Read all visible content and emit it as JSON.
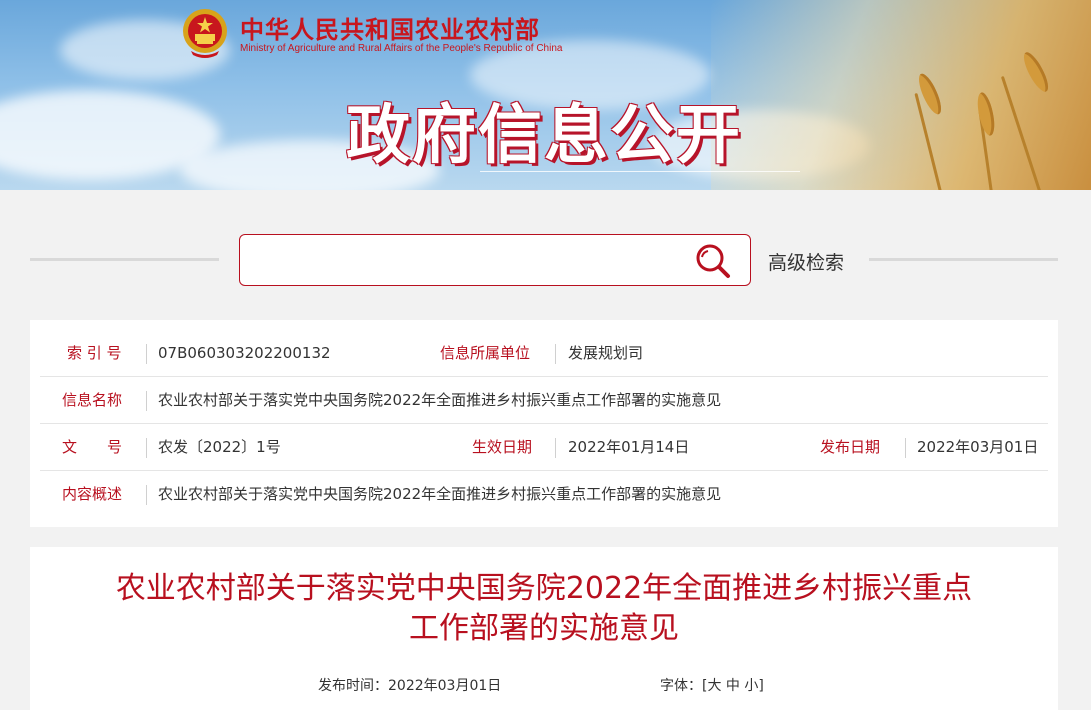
{
  "header": {
    "ministry_cn": "中华人民共和国农业农村部",
    "ministry_en": "Ministry of Agriculture and Rural Affairs of the People's Republic of China",
    "banner_title": "政府信息公开"
  },
  "search": {
    "placeholder": "",
    "value": "",
    "search_icon": "magnifier-icon",
    "advanced_label": "高级检索"
  },
  "meta": {
    "index_label": "索 引 号",
    "index_value": "07B060303202200132",
    "unit_label": "信息所属单位",
    "unit_value": "发展规划司",
    "name_label": "信息名称",
    "name_value": "农业农村部关于落实党中央国务院2022年全面推进乡村振兴重点工作部署的实施意见",
    "doc_label": "文　　号",
    "doc_value": "农发〔2022〕1号",
    "effective_label": "生效日期",
    "effective_value": "2022年01月14日",
    "publish_label": "发布日期",
    "publish_value": "2022年03月01日",
    "summary_label": "内容概述",
    "summary_value": "农业农村部关于落实党中央国务院2022年全面推进乡村振兴重点工作部署的实施意见"
  },
  "article": {
    "title_line1": "农业农村部关于落实党中央国务院2022年全面推进乡村振兴重点",
    "title_line2": "工作部署的实施意见",
    "publish_time": "发布时间：2022年03月01日",
    "font_label": "字体：[",
    "font_large": "大",
    "font_medium": "中",
    "font_small": "小",
    "font_close": "]"
  },
  "colors": {
    "accent": "#b8101f",
    "page_bg": "#f2f2f2"
  }
}
